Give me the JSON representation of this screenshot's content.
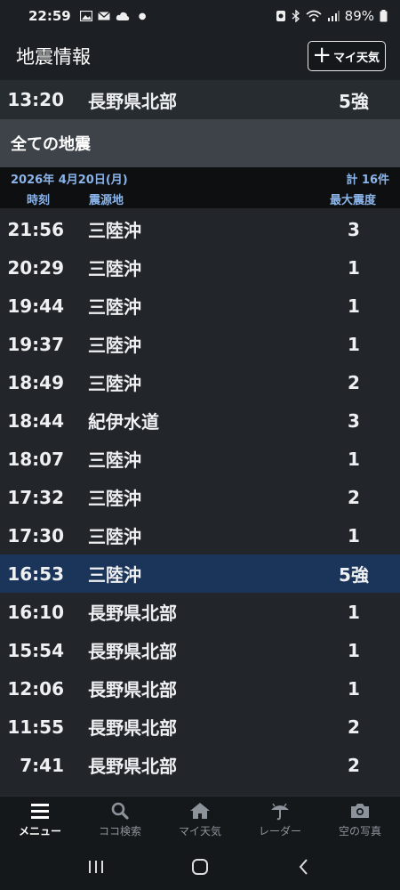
{
  "status": {
    "time": "22:59",
    "battery": "89%"
  },
  "appbar": {
    "title": "地震情報",
    "my_weather_button": "マイ天気"
  },
  "pinned": {
    "time": "13:20",
    "place": "長野県北部",
    "intensity": "5強"
  },
  "section_title": "全ての地震",
  "date_line": {
    "date": "2026年 4月20日(月)",
    "count": "計 16件"
  },
  "columns": {
    "time": "時刻",
    "place": "震源地",
    "intensity": "最大震度"
  },
  "quakes": [
    {
      "time": "21:56",
      "place": "三陸沖",
      "intensity": "3"
    },
    {
      "time": "20:29",
      "place": "三陸沖",
      "intensity": "1"
    },
    {
      "time": "19:44",
      "place": "三陸沖",
      "intensity": "1"
    },
    {
      "time": "19:37",
      "place": "三陸沖",
      "intensity": "1"
    },
    {
      "time": "18:49",
      "place": "三陸沖",
      "intensity": "2"
    },
    {
      "time": "18:44",
      "place": "紀伊水道",
      "intensity": "3"
    },
    {
      "time": "18:07",
      "place": "三陸沖",
      "intensity": "1"
    },
    {
      "time": "17:32",
      "place": "三陸沖",
      "intensity": "2"
    },
    {
      "time": "17:30",
      "place": "三陸沖",
      "intensity": "1"
    },
    {
      "time": "16:53",
      "place": "三陸沖",
      "intensity": "5強"
    },
    {
      "time": "16:10",
      "place": "長野県北部",
      "intensity": "1"
    },
    {
      "time": "15:54",
      "place": "長野県北部",
      "intensity": "1"
    },
    {
      "time": "12:06",
      "place": "長野県北部",
      "intensity": "1"
    },
    {
      "time": "11:55",
      "place": "長野県北部",
      "intensity": "2"
    },
    {
      "time": "7:41",
      "place": "長野県北部",
      "intensity": "2"
    }
  ],
  "bottom_nav": [
    {
      "label": "メニュー",
      "icon": "menu-icon",
      "active": true
    },
    {
      "label": "ココ検索",
      "icon": "search-icon",
      "active": false
    },
    {
      "label": "マイ天気",
      "icon": "home-icon",
      "active": false
    },
    {
      "label": "レーダー",
      "icon": "umbrella-icon",
      "active": false
    },
    {
      "label": "空の写真",
      "icon": "camera-icon",
      "active": false
    }
  ],
  "colors": {
    "highlight_row": "#1b3459",
    "header_blue_text": "#8ab4ea",
    "background": "#22262b"
  }
}
